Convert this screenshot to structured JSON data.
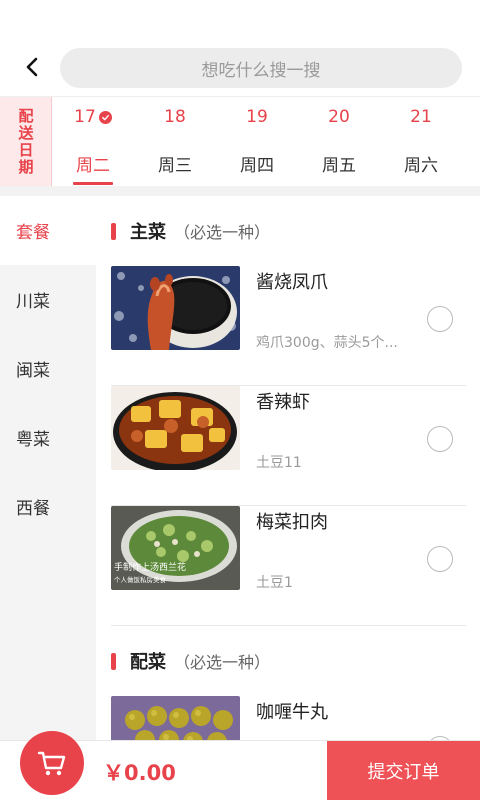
{
  "search": {
    "placeholder": "想吃什么搜一搜"
  },
  "delivery_label": "配送日期",
  "days": [
    {
      "date": "17",
      "weekday": "周二",
      "selected": true,
      "checked": true
    },
    {
      "date": "18",
      "weekday": "周三",
      "selected": false
    },
    {
      "date": "19",
      "weekday": "周四",
      "selected": false
    },
    {
      "date": "20",
      "weekday": "周五",
      "selected": false
    },
    {
      "date": "21",
      "weekday": "周六",
      "selected": false
    }
  ],
  "sidebar": {
    "items": [
      {
        "label": "套餐",
        "active": true
      },
      {
        "label": "川菜"
      },
      {
        "label": "闽菜"
      },
      {
        "label": "粤菜"
      },
      {
        "label": "西餐"
      }
    ]
  },
  "sections": [
    {
      "name": "主菜",
      "note": "（必选一种）",
      "dishes": [
        {
          "name": "酱烧凤爪",
          "desc": "鸡爪300g、蒜头5个...",
          "image": "chicken-feet-photo"
        },
        {
          "name": "香辣虾",
          "desc": "土豆11",
          "image": "spicy-shrimp-photo"
        },
        {
          "name": "梅菜扣肉",
          "desc": "土豆1",
          "image": "braised-pork-photo",
          "overlay_text": [
            "手制作上汤西兰花",
            "个人做饭私房美食"
          ]
        }
      ]
    },
    {
      "name": "配菜",
      "note": "（必选一种）",
      "dishes": [
        {
          "name": "咖喱牛丸",
          "desc": "",
          "image": "curry-beef-balls-photo"
        }
      ]
    }
  ],
  "bottom": {
    "total": "￥0.00",
    "submit_label": "提交订单"
  },
  "colors": {
    "accent": "#e8424a",
    "submit": "#ee5156"
  }
}
